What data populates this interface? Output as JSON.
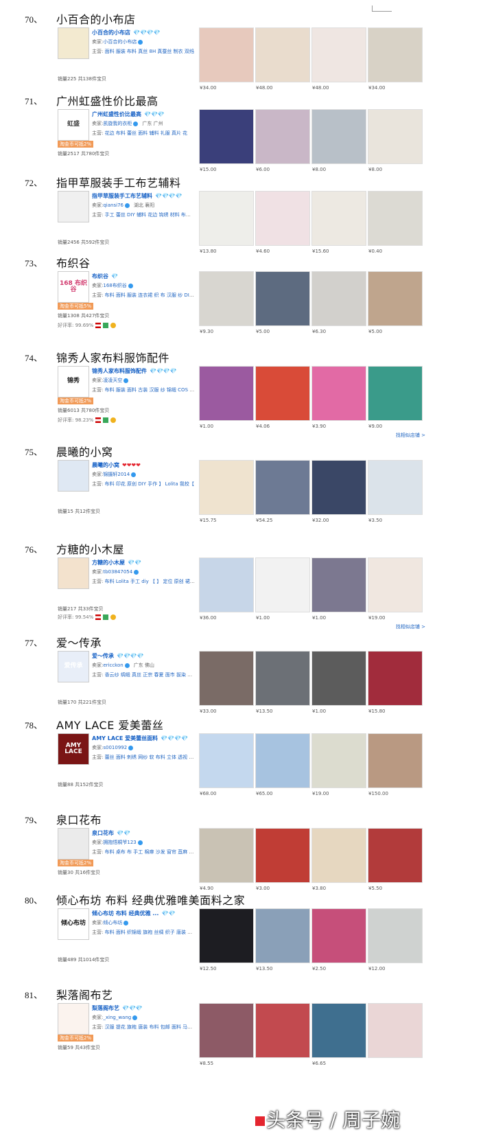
{
  "entries": [
    {
      "num": "70、",
      "title": "小百合的小布店",
      "logo_text": "",
      "shop_name": "小百合的小布店",
      "rank": "💎💎💎💎",
      "rank_style": "diamond",
      "seller_label": "卖家:",
      "seller": "小百合的小布店",
      "location": "",
      "main_label": "主营:",
      "main": "面料 服装 布料 真丝 8H 真蚕丝 制衣 双绉",
      "badge": "",
      "sales": "销量225  共138件宝贝",
      "rating": "",
      "more": "",
      "prices": [
        "¥34.00",
        "¥48.00",
        "¥48.00",
        "¥34.00"
      ]
    },
    {
      "num": "71、",
      "title": "广州虹盛性价比最高",
      "logo_text": "虹盛",
      "shop_name": "广州虹盛性价比最高",
      "rank": "💎💎💎",
      "rank_style": "diamond",
      "seller_label": "卖家:",
      "seller": "凯旋我的衣柜",
      "location": "广东 广州",
      "main_label": "主营:",
      "main": "花边 布料 蕾丝 面料 辅料 礼服 真片 花",
      "badge": "淘金币可抵2%",
      "sales": "销量2517  共780件宝贝",
      "rating": "",
      "more": "",
      "prices": [
        "¥15.00",
        "¥6.00",
        "¥8.00",
        "¥8.00"
      ]
    },
    {
      "num": "72、",
      "title": "指甲草服装手工布艺辅料",
      "logo_text": "",
      "shop_name": "指甲草服装手工布艺辅料",
      "rank": "💎💎💎💎",
      "rank_style": "diamond",
      "seller_label": "卖家:",
      "seller": "qiansi76",
      "location": "湖北 襄阳",
      "main_label": "主营:",
      "main": "手工 蕾丝 DIY 辅料 花边 钩绣 材料 布料 网",
      "badge": "",
      "sales": "销量2456  共592件宝贝",
      "rating": "",
      "more": "",
      "prices": [
        "¥13.80",
        "¥4.60",
        "¥15.60",
        "¥0.40"
      ]
    },
    {
      "num": "73、",
      "title": "布织谷",
      "logo_text": "168 布织谷",
      "shop_name": "布织谷",
      "rank": "💎",
      "rank_style": "diamond",
      "seller_label": "卖家:",
      "seller": "168布织谷",
      "location": "",
      "main_label": "主营:",
      "main": "布料 面料 服装 连衣裙 织 布 汉服 纱 DIY 衬",
      "badge": "淘金币可抵5%",
      "sales": "销量1308  共427件宝贝",
      "rating": "好评率: 99.69%",
      "more": "",
      "prices": [
        "¥9.30",
        "¥5.00",
        "¥6.30",
        "¥5.00"
      ]
    },
    {
      "num": "74、",
      "title": "锦秀人家布料服饰配件",
      "logo_text": "锦秀",
      "shop_name": "锦秀人家布料服饰配件",
      "rank": "💎💎💎💎",
      "rank_style": "diamond",
      "seller_label": "卖家:",
      "seller": "凌凌天空",
      "location": "",
      "main_label": "主营:",
      "main": "布料 服装 面料 古装 汉服 纱 锦缎 COS 旗袍",
      "badge": "淘金币可抵2%",
      "sales": "销量6013  共780件宝贝",
      "rating": "好评率: 98.23%",
      "more": "找相似店铺 >",
      "prices": [
        "¥1.00",
        "¥4.06",
        "¥3.90",
        "¥9.00"
      ]
    },
    {
      "num": "75、",
      "title": "晨曦的小窝",
      "logo_text": "",
      "shop_name": "晨曦的小窝",
      "rank": "❤❤❤❤",
      "rank_style": "heart",
      "seller_label": "卖家:",
      "seller": "锦摄轩2014",
      "location": "",
      "main_label": "主营:",
      "main": "布料 印花 原创 DIY 手作 】 Lolita 我校【",
      "badge": "",
      "sales": "销量15  共12件宝贝",
      "rating": "",
      "more": "",
      "prices": [
        "¥15.75",
        "¥54.25",
        "¥32.00",
        "¥3.50"
      ]
    },
    {
      "num": "76、",
      "title": "方糖的小木屋",
      "logo_text": "",
      "shop_name": "方糖的小木屋",
      "rank": "💎💎",
      "rank_style": "diamond",
      "seller_label": "卖家:",
      "seller": "tb03847054",
      "location": "",
      "main_label": "主营:",
      "main": "布料 Lolita 手工 diy 【 】 定位 原创 裙 床单",
      "badge": "",
      "sales": "销量217  共33件宝贝",
      "rating": "好评率: 99.54%",
      "more": "找相似店铺 >",
      "prices": [
        "¥36.00",
        "¥1.00",
        "¥1.00",
        "¥19.00"
      ]
    },
    {
      "num": "77、",
      "title": "爱～传承",
      "logo_text": "爱传承",
      "shop_name": "爱～传承",
      "rank": "💎💎💎💎",
      "rank_style": "diamond",
      "seller_label": "卖家:",
      "seller": "ericckon",
      "location": "广东 佛山",
      "main_label": "主营:",
      "main": "香云纱 绸缎 真丝 正宗 春夏 面市 拔染 真 纱",
      "badge": "",
      "sales": "销量170  共221件宝贝",
      "rating": "",
      "more": "",
      "prices": [
        "¥33.00",
        "¥13.50",
        "¥1.00",
        "¥15.80"
      ]
    },
    {
      "num": "78、",
      "title": "AMY LACE 爱美蕾丝",
      "logo_text": "AMY LACE",
      "shop_name": "AMY LACE 爱美蕾丝面料",
      "rank": "💎💎💎💎",
      "rank_style": "diamond",
      "seller_label": "卖家:",
      "seller": "s0010992",
      "location": "",
      "main_label": "主营:",
      "main": "蕾丝 面料 刺绣 网纱 软 布料 立体 透视 R 高",
      "badge": "",
      "sales": "销量88  共152件宝贝",
      "rating": "",
      "more": "",
      "prices": [
        "¥68.00",
        "¥65.00",
        "¥19.00",
        "¥150.00"
      ]
    },
    {
      "num": "79、",
      "title": "泉口花布",
      "logo_text": "",
      "shop_name": "泉口花布",
      "rank": "💎💎",
      "rank_style": "diamond",
      "seller_label": "卖家:",
      "seller": "拥抱悟桐爷123",
      "location": "",
      "main_label": "主营:",
      "main": "布料 桌布 布 手工 棉麻 沙发 窗帘 苴麻 抱枕 印",
      "badge": "淘金币可抵2%",
      "sales": "销量30  共16件宝贝",
      "rating": "",
      "more": "",
      "prices": [
        "¥4.90",
        "¥3.00",
        "¥3.80",
        "¥5.50"
      ]
    },
    {
      "num": "80、",
      "title": "倾心布坊 布料 经典优雅唯美面料之家",
      "logo_text": "倾心布坊",
      "shop_name": "倾心布坊 布料 经典优雅 ...",
      "rank": "💎💎",
      "rank_style": "diamond",
      "seller_label": "卖家:",
      "seller": "倾心布坊",
      "location": "",
      "main_label": "主营:",
      "main": "布料 面料 织锦缎 旗袍 丝绸 织子 唐装 古装",
      "badge": "",
      "sales": "销量489  共1014件宝贝",
      "rating": "",
      "more": "",
      "prices": [
        "¥12.50",
        "¥13.50",
        "¥2.50",
        "¥12.00"
      ]
    },
    {
      "num": "81、",
      "title": "梨落阁布艺",
      "logo_text": "",
      "shop_name": "梨落阁布艺",
      "rank": "💎💎💎",
      "rank_style": "diamond",
      "seller_label": "卖家:",
      "seller": "_xing_wang",
      "location": "",
      "main_label": "主营:",
      "main": "汉服 提花 旗袍 唐装 布料 包邮 面料 马面裙",
      "badge": "淘金币可抵2%",
      "sales": "销量59  共43件宝贝",
      "rating": "",
      "more": "",
      "prices": [
        "¥8.55",
        "",
        "¥6.65",
        ""
      ]
    }
  ],
  "watermark": "头条号 / 周子婉",
  "colors": {
    "link": "#1560c5",
    "badge": "#f19a57",
    "heart": "#e4252f"
  }
}
